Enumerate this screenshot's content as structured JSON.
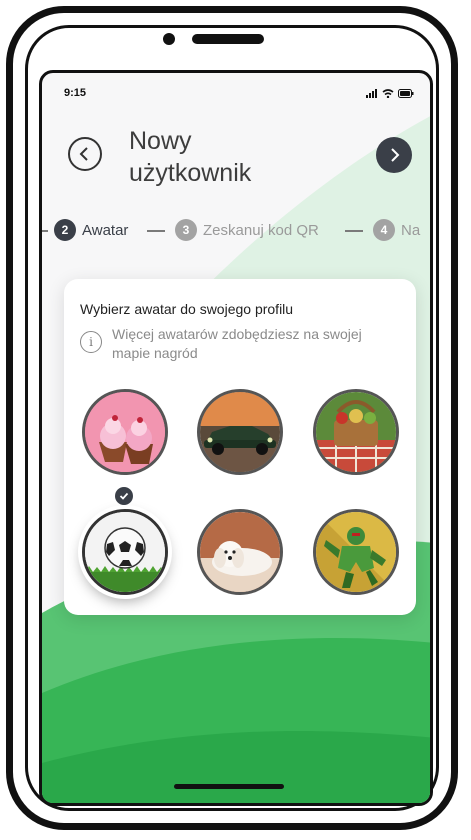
{
  "status_bar": {
    "time": "9:15"
  },
  "header": {
    "title_line1": "Nowy",
    "title_line2": "użytkownik"
  },
  "stepper": [
    {
      "number": "2",
      "label": "Awatar",
      "state": "active"
    },
    {
      "number": "3",
      "label": "Zeskanuj kod QR",
      "state": "upcoming"
    },
    {
      "number": "4",
      "label": "Na",
      "state": "upcoming"
    }
  ],
  "card": {
    "title": "Wybierz awatar do swojego profilu",
    "info_text": "Więcej awatarów zdobędziesz na swojej mapie nagród"
  },
  "avatars": [
    {
      "subject": "cupcakes",
      "selected": false
    },
    {
      "subject": "car",
      "selected": false
    },
    {
      "subject": "picnic-basket",
      "selected": false
    },
    {
      "subject": "football",
      "selected": true
    },
    {
      "subject": "dog",
      "selected": false
    },
    {
      "subject": "superhero",
      "selected": false
    }
  ],
  "colors": {
    "accent_dark": "#3a3f48",
    "step_active": "#3a3f48",
    "step_inactive": "#9a9a9a",
    "green": "#3cbf5c"
  }
}
